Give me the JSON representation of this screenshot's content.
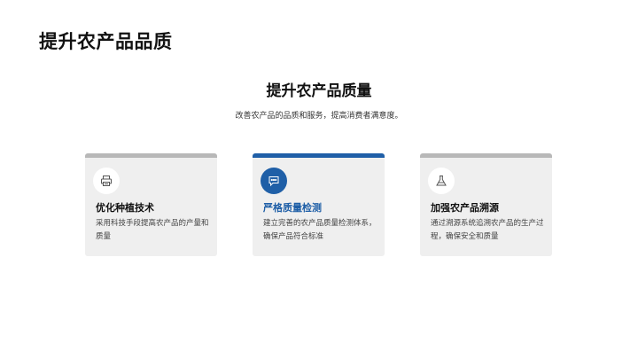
{
  "slide": {
    "title": "提升农产品品质",
    "heading": "提升农产品质量",
    "subtitle": "改善农产品的品质和服务，提高消费者满意度。"
  },
  "cards": [
    {
      "icon": "printer-icon",
      "title": "优化种植技术",
      "description": "采用科技手段提高农产品的产量和质量",
      "active": false
    },
    {
      "icon": "chat-bubble-icon",
      "title": "严格质量检测",
      "description": "建立完善的农产品质量检测体系，确保产品符合标准",
      "active": true
    },
    {
      "icon": "flask-icon",
      "title": "加强农产品溯源",
      "description": "通过溯源系统追溯农产品的生产过程，确保安全和质量",
      "active": false
    }
  ],
  "colors": {
    "accent": "#1f5fa7",
    "card_background": "#efefef",
    "card_top_border": "#b8b8b8"
  }
}
